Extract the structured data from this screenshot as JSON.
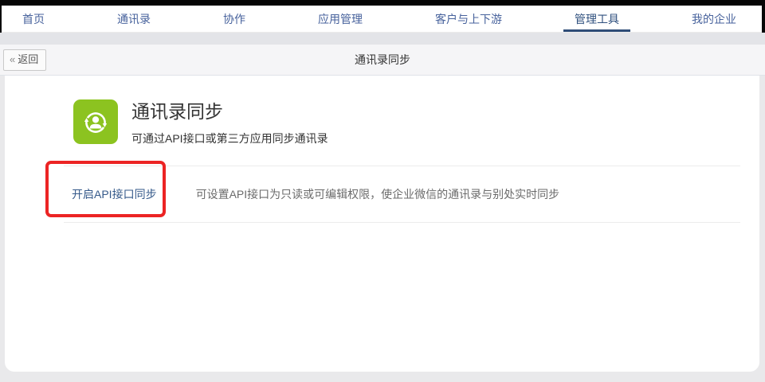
{
  "nav": {
    "items": [
      {
        "label": "首页",
        "active": false
      },
      {
        "label": "通讯录",
        "active": false
      },
      {
        "label": "协作",
        "active": false
      },
      {
        "label": "应用管理",
        "active": false
      },
      {
        "label": "客户与上下游",
        "active": false
      },
      {
        "label": "管理工具",
        "active": true
      },
      {
        "label": "我的企业",
        "active": false
      }
    ]
  },
  "subheader": {
    "back_chevron": "«",
    "back_label": "返回",
    "title": "通讯录同步"
  },
  "main": {
    "hero": {
      "icon": "contacts-sync-icon",
      "title": "通讯录同步",
      "subtitle": "可通过API接口或第三方应用同步通讯录"
    },
    "rows": [
      {
        "link": "开启API接口同步",
        "description": "可设置API接口为只读或可编辑权限，使企业微信的通讯录与别处实时同步"
      }
    ],
    "annotation": "red-box-highlight-around-api-sync-link"
  },
  "colors": {
    "nav_text": "#47629c",
    "nav_active_underline": "#2e4c77",
    "icon_green": "#8cc320",
    "link_blue": "#35598a",
    "annotation_red": "#ec2424"
  }
}
